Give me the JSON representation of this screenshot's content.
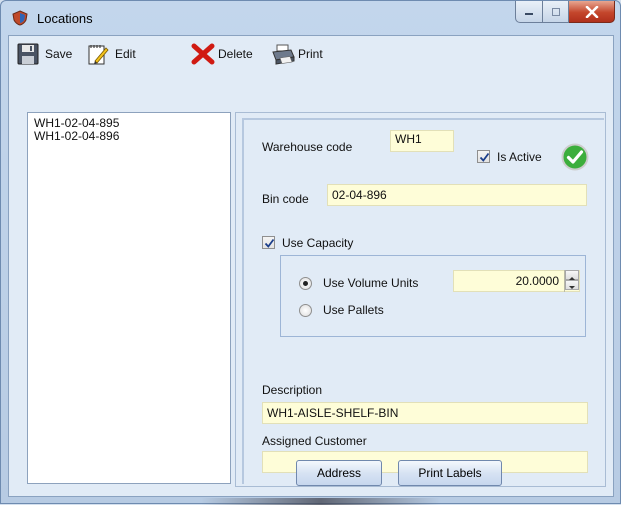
{
  "window": {
    "title": "Locations",
    "icon": "shield-icon"
  },
  "toolbar": {
    "save_label": "Save",
    "edit_label": "Edit",
    "delete_label": "Delete",
    "print_label": "Print"
  },
  "locations_list": {
    "items": [
      "WH1-02-04-895",
      "WH1-02-04-896"
    ]
  },
  "details": {
    "warehouse_code_label": "Warehouse code",
    "warehouse_code_value": "WH1",
    "is_active_label": "Is Active",
    "is_active_checked": true,
    "bin_code_label": "Bin code",
    "bin_code_value": "02-04-896",
    "use_capacity_label": "Use Capacity",
    "use_capacity_checked": true,
    "use_volume_units_label": "Use Volume Units",
    "use_volume_units_selected": true,
    "volume_value": "20.0000",
    "use_pallets_label": "Use Pallets",
    "use_pallets_selected": false,
    "description_label": "Description",
    "description_value": "WH1-AISLE-SHELF-BIN",
    "assigned_customer_label": "Assigned Customer",
    "assigned_customer_value": ""
  },
  "buttons": {
    "address_label": "Address",
    "print_labels_label": "Print Labels"
  },
  "colors": {
    "field_background": "#fefdd8",
    "active_check_green": "#3cae3c",
    "delete_red": "#d01a12"
  }
}
